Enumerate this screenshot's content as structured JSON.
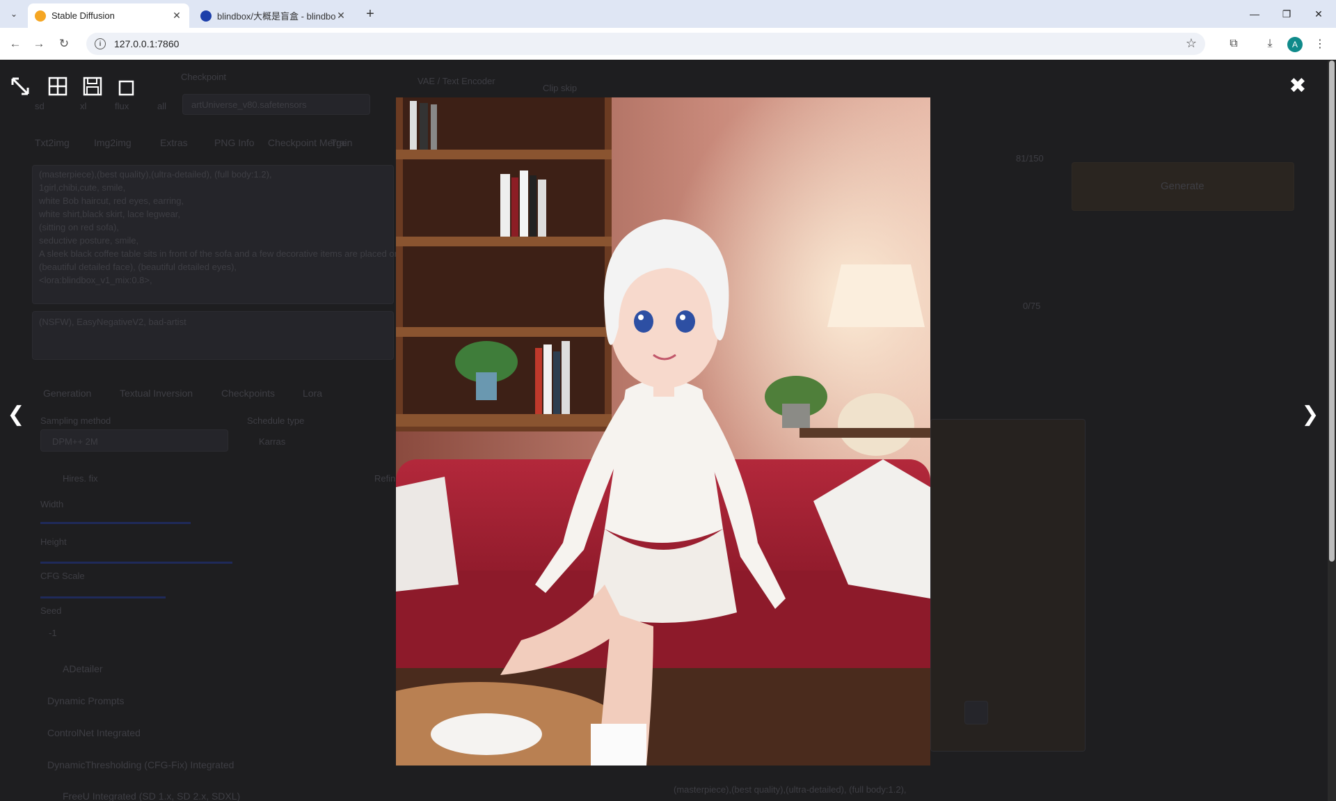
{
  "browser": {
    "tabs": [
      {
        "title": "Stable Diffusion",
        "active": true
      },
      {
        "title": "blindbox/大概是盲盒 - blindbox",
        "active": false
      }
    ],
    "address": "127.0.0.1:7860",
    "profile_initial": "A"
  },
  "background_page": {
    "tabs": [
      "Txt2img",
      "Img2img",
      "Extras",
      "PNG Info",
      "Checkpoint Merger",
      "Train"
    ],
    "prompt_lines": [
      "(masterpiece),(best quality),(ultra-detailed), (full body:1.2),",
      "1girl,chibi,cute, smile,",
      "white Bob haircut, red eyes, earring,",
      "white shirt,black skirt, lace legwear,",
      "(sitting on red sofa),",
      "seductive posture, smile,",
      "A sleek black coffee table sits in front of the sofa and a few decorative items are placed on it,",
      "(beautiful detailed face), (beautiful detailed eyes),",
      "<lora:blindbox_v1_mix:0.8>,"
    ],
    "negative_prompt": "(NSFW), EasyNegativeV2, bad-artist",
    "subtabs": [
      "Generation",
      "Textual Inversion",
      "Checkpoints",
      "Lora"
    ],
    "sampling_method_label": "Sampling method",
    "sampling_method": "DPM++ 2M",
    "schedule_label": "Schedule type",
    "schedule": "Karras",
    "hires_label": "Hires. fix",
    "refiner_label": "Refiner",
    "width_label": "Width",
    "height_label": "Height",
    "cfg_label": "CFG Scale",
    "seed_label": "Seed",
    "seed_value": "-1",
    "accordions": [
      "ADetailer",
      "Dynamic Prompts",
      "ControlNet Integrated",
      "DynamicThresholding (CFG-Fix) Integrated",
      "FreeU Integrated (SD 1.x, SD 2.x, SDXL)"
    ],
    "checkpoint_label": "Checkpoint",
    "checkpoint": "artUniverse_v80.safetensors",
    "ui_modes": [
      "sd",
      "xl",
      "flux",
      "all"
    ],
    "vae_label": "VAE / Text Encoder",
    "clipskip_label": "Clip skip",
    "counter": "81/150",
    "counter2": "0/75",
    "generate_label": "Generate",
    "output_caption": "(masterpiece),(best quality),(ultra-detailed), (full body:1.2),"
  },
  "lightbox": {
    "tools": [
      "fullscreen-icon",
      "grid-icon",
      "save-icon",
      "fit-icon"
    ],
    "close_glyph": "✖",
    "prev_glyph": "❮",
    "next_glyph": "❯"
  }
}
